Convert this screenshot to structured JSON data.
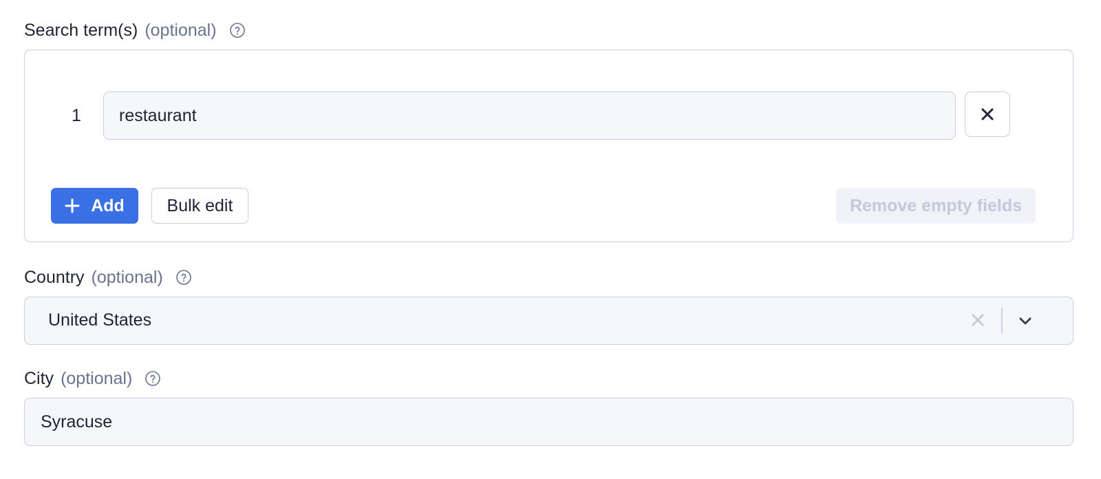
{
  "search_terms": {
    "label": "Search term(s)",
    "optional": "(optional)",
    "help_icon": "question-circle-icon",
    "items": [
      {
        "index": "1",
        "value": "restaurant"
      }
    ],
    "add_label": "Add",
    "add_icon": "plus-icon",
    "bulk_edit_label": "Bulk edit",
    "remove_empty_label": "Remove empty fields",
    "remove_icon": "close-icon"
  },
  "country": {
    "label": "Country",
    "optional": "(optional)",
    "help_icon": "question-circle-icon",
    "selected": "United States",
    "clear_icon": "close-icon",
    "dropdown_icon": "chevron-down-icon"
  },
  "city": {
    "label": "City",
    "optional": "(optional)",
    "help_icon": "question-circle-icon",
    "value": "Syracuse"
  },
  "colors": {
    "accent": "#3a6fe6",
    "text": "#1f2433",
    "muted": "#6b7290",
    "border": "#c9cde0",
    "field_bg": "#f6f7fb",
    "disabled_text": "#c4c8db"
  }
}
